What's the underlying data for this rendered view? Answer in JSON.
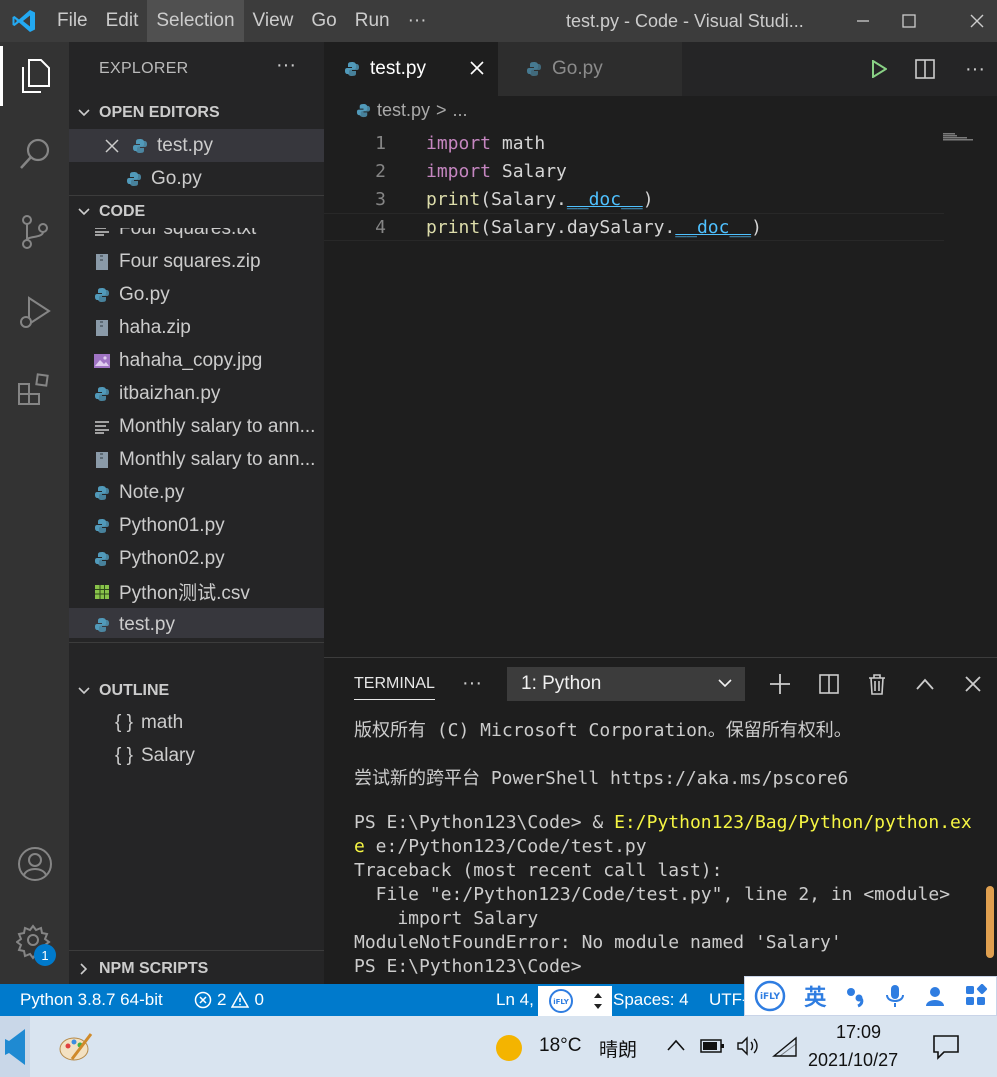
{
  "titlebar": {
    "menu": [
      "File",
      "Edit",
      "Selection",
      "View",
      "Go",
      "Run",
      "···"
    ],
    "active_menu": "Selection",
    "title": "test.py - Code - Visual Studi..."
  },
  "sidebar": {
    "header": "EXPLORER",
    "header_more": "···",
    "open_editors": {
      "label": "OPEN EDITORS",
      "items": [
        "test.py",
        "Go.py"
      ]
    },
    "code": {
      "label": "CODE",
      "items": [
        {
          "name": "Four squares.txt",
          "icon": "text-file-icon"
        },
        {
          "name": "Four squares.zip",
          "icon": "zip-file-icon"
        },
        {
          "name": "Go.py",
          "icon": "python-file-icon"
        },
        {
          "name": "haha.zip",
          "icon": "zip-file-icon"
        },
        {
          "name": "hahaha_copy.jpg",
          "icon": "image-file-icon"
        },
        {
          "name": "itbaizhan.py",
          "icon": "python-file-icon"
        },
        {
          "name": "Monthly salary to ann...",
          "icon": "text-file-icon"
        },
        {
          "name": "Monthly salary to ann...",
          "icon": "zip-file-icon"
        },
        {
          "name": "Note.py",
          "icon": "python-file-icon"
        },
        {
          "name": "Python01.py",
          "icon": "python-file-icon"
        },
        {
          "name": "Python02.py",
          "icon": "python-file-icon"
        },
        {
          "name": "Python测试.csv",
          "icon": "csv-file-icon"
        },
        {
          "name": "test.py",
          "icon": "python-file-icon"
        }
      ]
    },
    "outline": {
      "label": "OUTLINE",
      "items": [
        "math",
        "Salary"
      ],
      "symbol": "{ }"
    },
    "npm_scripts": "NPM SCRIPTS"
  },
  "editor": {
    "tabs": [
      {
        "label": "test.py",
        "active": true
      },
      {
        "label": "Go.py",
        "active": false
      }
    ],
    "breadcrumb": {
      "file": "test.py",
      "sep": ">",
      "rest": "..."
    },
    "lines": [
      {
        "n": "1",
        "parts": [
          [
            "kw",
            "import"
          ],
          [
            "id",
            " math"
          ]
        ]
      },
      {
        "n": "2",
        "parts": [
          [
            "kw",
            "import"
          ],
          [
            "id",
            " Salary"
          ]
        ]
      },
      {
        "n": "3",
        "parts": [
          [
            "fn",
            "print"
          ],
          [
            "id",
            "(Salary."
          ],
          [
            "dn",
            "__doc__"
          ],
          [
            "id",
            ")"
          ]
        ]
      },
      {
        "n": "4",
        "parts": [
          [
            "fn",
            "print"
          ],
          [
            "id",
            "(Salary.daySalary."
          ],
          [
            "dn",
            "__doc__"
          ],
          [
            "id",
            ")"
          ]
        ]
      }
    ]
  },
  "terminal": {
    "tab_label": "TERMINAL",
    "more": "···",
    "selected_shell": "1: Python",
    "lines": [
      [
        [
          "t",
          "版权所有 (C) Microsoft Corporation。保留所有权利。"
        ]
      ],
      [
        [
          "t",
          ""
        ]
      ],
      [
        [
          "t",
          "尝试新的跨平台 PowerShell https://aka.ms/pscore6"
        ]
      ],
      [
        [
          "t",
          ""
        ]
      ],
      [
        [
          "t",
          "PS E:\\Python123\\Code> & "
        ],
        [
          "y",
          "E:/Python123/Bag/Python/python.ex"
        ]
      ],
      [
        [
          "y",
          "e"
        ],
        [
          "t",
          " e:/Python123/Code/test.py"
        ]
      ],
      [
        [
          "t",
          "Traceback (most recent call last):"
        ]
      ],
      [
        [
          "t",
          "  File \"e:/Python123/Code/test.py\", line 2, in <module>"
        ]
      ],
      [
        [
          "t",
          "    import Salary"
        ]
      ],
      [
        [
          "t",
          "ModuleNotFoundError: No module named 'Salary'"
        ]
      ],
      [
        [
          "t",
          "PS E:\\Python123\\Code>"
        ]
      ]
    ]
  },
  "statusbar": {
    "interpreter": "Python 3.8.7 64-bit",
    "errors": "2",
    "warnings": "0",
    "position": "Ln 4,",
    "spaces": "Spaces: 4",
    "encoding": "UTF-"
  },
  "ifly": {
    "lang": "英",
    "badge": "iFLY"
  },
  "taskbar": {
    "temperature": "18°C",
    "weather": "晴朗",
    "time": "17:09",
    "date": "2021/10/27",
    "settings_badge": "1"
  },
  "colors": {
    "accent": "#007acc",
    "keyword": "#c586c0",
    "function": "#dcdcaa",
    "dunder": "#4fc1ff",
    "terminal_yellow": "#f5f543"
  }
}
